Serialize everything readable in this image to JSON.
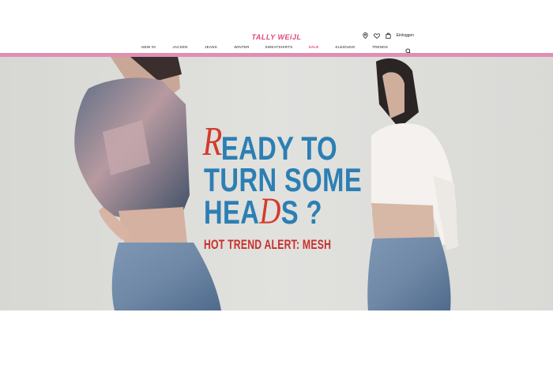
{
  "header": {
    "logo_text": "TALLY WEiJL",
    "login_label": "Einloggen",
    "icons": [
      "location-pin-icon",
      "heart-icon",
      "shopping-bag-icon",
      "search-icon"
    ]
  },
  "nav": {
    "items": [
      {
        "label": "NEW IN"
      },
      {
        "label": "JACKEN"
      },
      {
        "label": "JEANS"
      },
      {
        "label": "WINTER"
      },
      {
        "label": "SWEATSHIRTS"
      },
      {
        "label": "SALE"
      },
      {
        "label": "KLEIDUNG"
      },
      {
        "label": "TRENDS"
      }
    ]
  },
  "hero": {
    "headline_line1": "EADY TO",
    "headline_r": "R",
    "headline_line2": "TURN SOME",
    "headline_line3_a": "HEA",
    "headline_d": "D",
    "headline_line3_b": "S ?",
    "subline": "HOT TREND ALERT: MESH"
  },
  "colors": {
    "brand_pink": "#e0467e",
    "accent_bar": "#e08fb4",
    "headline_blue": "#2c7fb3",
    "headline_red": "#d33b2c"
  }
}
